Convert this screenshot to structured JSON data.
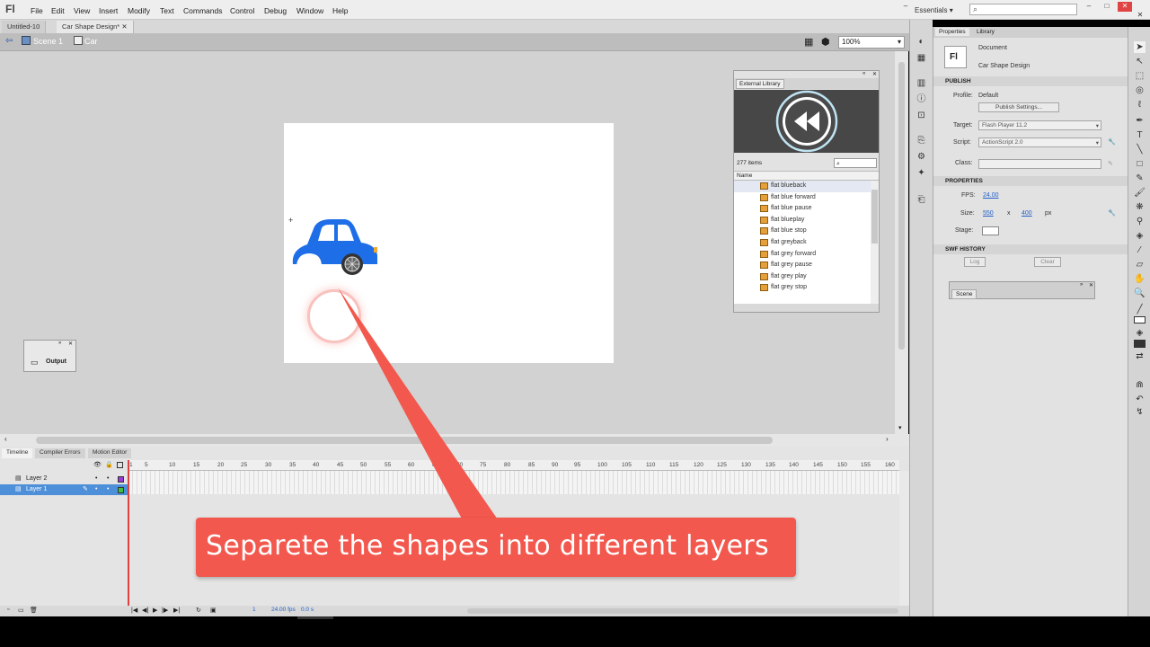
{
  "app": {
    "logo": "Fl",
    "workspace": "Essentials",
    "window_controls": [
      "–",
      "□",
      "✕",
      "–",
      "□",
      "✕"
    ]
  },
  "menu": [
    "File",
    "Edit",
    "View",
    "Insert",
    "Modify",
    "Text",
    "Commands",
    "Control",
    "Debug",
    "Window",
    "Help"
  ],
  "doc_tabs": [
    {
      "label": "Untitled-10"
    },
    {
      "label": "Car Shape Design*"
    }
  ],
  "breadcrumb": {
    "scene": "Scene 1",
    "symbol": "Car"
  },
  "zoom": "100%",
  "external_library": {
    "title": "External Library",
    "count": "277 items",
    "column": "Name",
    "items": [
      "flat blueback",
      "flat blue forward",
      "flat blue pause",
      "flat blueplay",
      "flat blue stop",
      "flat greyback",
      "flat grey forward",
      "flat grey pause",
      "flat grey play",
      "flat grey stop"
    ]
  },
  "output_panel": {
    "label": "Output"
  },
  "timeline": {
    "tabs": [
      "Timeline",
      "Compiler Errors",
      "Motion Editor"
    ],
    "ruler": [
      "1",
      "5",
      "10",
      "15",
      "20",
      "25",
      "30",
      "35",
      "40",
      "45",
      "50",
      "55",
      "60",
      "65",
      "70",
      "75",
      "80",
      "85",
      "90",
      "95",
      "100",
      "105",
      "110",
      "115",
      "120",
      "125",
      "130",
      "135",
      "140",
      "145",
      "150",
      "155",
      "160"
    ],
    "layers": [
      {
        "name": "Layer 2",
        "color": "#9b3bd6"
      },
      {
        "name": "Layer 1",
        "color": "#3fbf3f"
      }
    ],
    "footer": {
      "frame": "1",
      "fps": "24.00 fps",
      "time": "0.0 s"
    }
  },
  "properties": {
    "tabs": [
      "Properties",
      "Library"
    ],
    "doc_kind": "Document",
    "doc_name": "Car Shape Design",
    "thumb": "Fl",
    "publish_header": "PUBLISH",
    "profile_label": "Profile:",
    "profile_value": "Default",
    "publish_settings": "Publish Settings...",
    "target_label": "Target:",
    "target_value": "Flash Player 11.2",
    "script_label": "Script:",
    "script_value": "ActionScript 2.0",
    "class_label": "Class:",
    "properties_header": "PROPERTIES",
    "fps_label": "FPS:",
    "fps_value": "24.00",
    "size_label": "Size:",
    "size_w": "550",
    "size_x": "x",
    "size_h": "400",
    "size_unit": "px",
    "stage_label": "Stage:",
    "swf_header": "SWF HISTORY",
    "log_button": "Log",
    "clear_button": "Clear",
    "scene_panel": "Scene"
  },
  "callout": {
    "text": "Separete the shapes into different layers",
    "color": "#f2584d"
  },
  "colors": {
    "car_blue": "#1e6ee8",
    "accent_red": "#f2584d"
  }
}
